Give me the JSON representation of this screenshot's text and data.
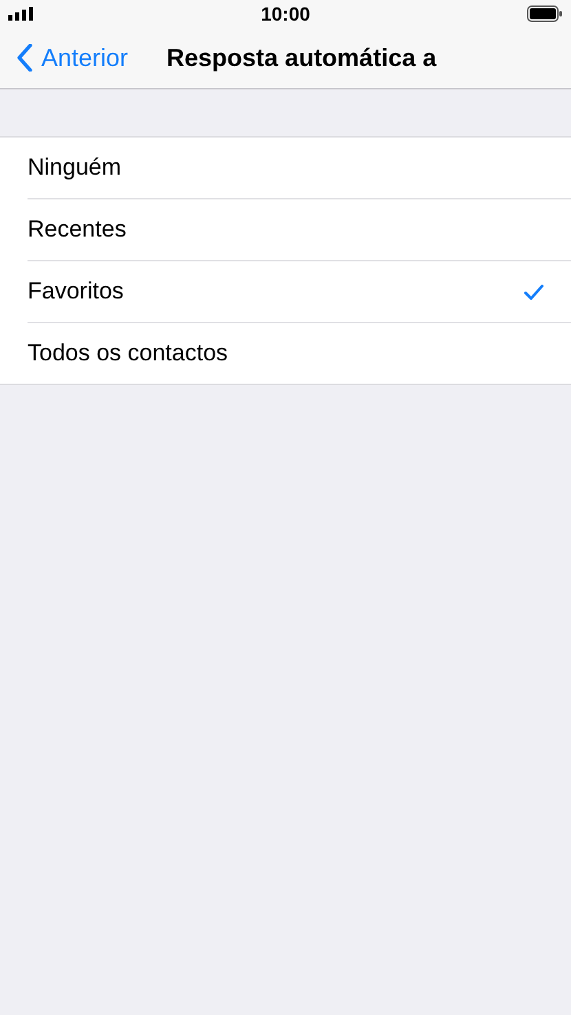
{
  "status_bar": {
    "time": "10:00"
  },
  "nav": {
    "back": "Anterior",
    "title": "Resposta automática a"
  },
  "options": [
    {
      "label": "Ninguém",
      "selected": false
    },
    {
      "label": "Recentes",
      "selected": false
    },
    {
      "label": "Favoritos",
      "selected": true
    },
    {
      "label": "Todos os contactos",
      "selected": false
    }
  ]
}
